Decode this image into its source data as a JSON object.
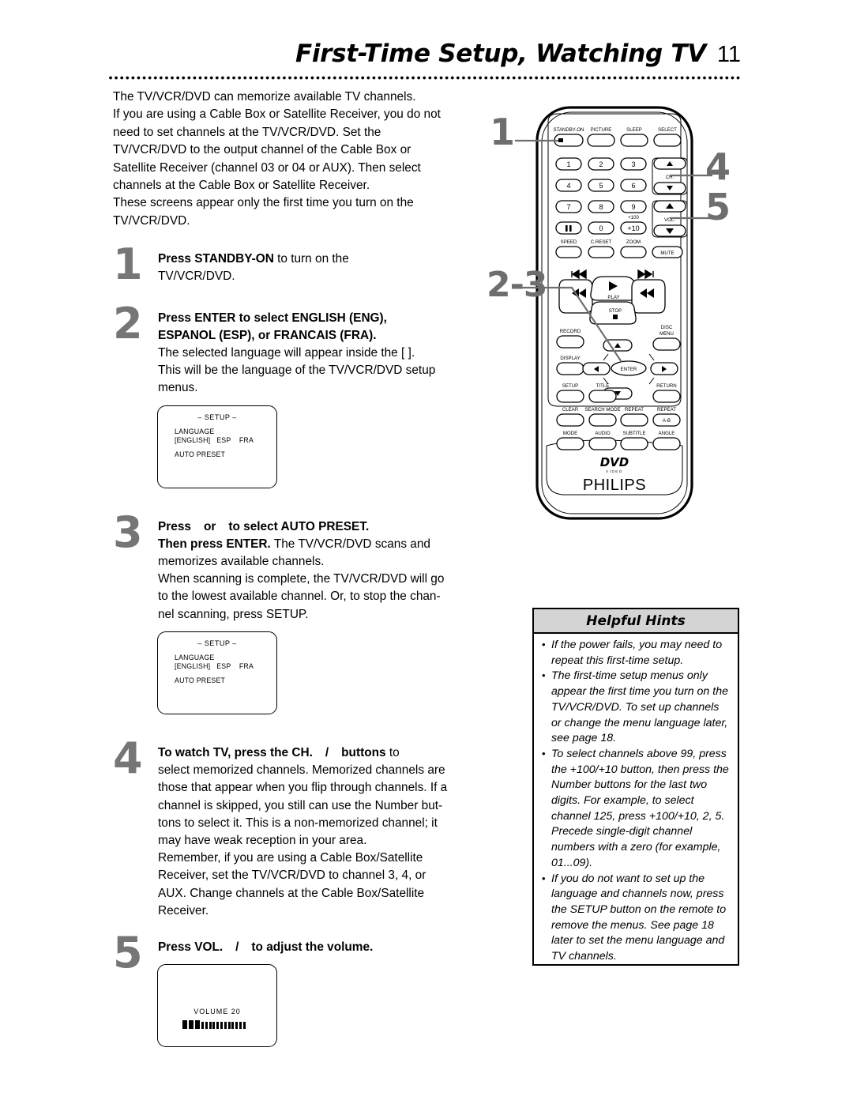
{
  "header": {
    "title": "First-Time Setup, Watching TV",
    "page_number": "11"
  },
  "intro": {
    "lines": [
      "The TV/VCR/DVD can memorize available TV channels.",
      "If you are using a Cable Box or Satellite Receiver, you do not",
      "need to set channels at the TV/VCR/DVD. Set the",
      "TV/VCR/DVD to the output channel of the Cable Box or",
      "Satellite Receiver (channel 03 or 04 or AUX). Then select",
      "channels at the Cable Box or Satellite Receiver.",
      "These screens appear only the first time you turn on the",
      "TV/VCR/DVD."
    ]
  },
  "steps": [
    {
      "number": "1",
      "bold_lead": "Press STANDBY-ON",
      "lead_rest": " to turn on the",
      "lines": [
        "TV/VCR/DVD."
      ]
    },
    {
      "number": "2",
      "bold_line_1": "Press ENTER to select ENGLISH (ENG),",
      "bold_line_2": "ESPANOL (ESP), or FRANCAIS (FRA).",
      "lines": [
        "The selected language will appear inside the [ ].",
        "This will be the language of the TV/VCR/DVD setup",
        "menus."
      ]
    },
    {
      "number": "3",
      "bold_line_1_a": "Press",
      "bold_line_1_b": "or",
      "bold_line_1_c": "to select AUTO PRESET.",
      "bold_line_2": "Then press ENTER.",
      "line_2_rest": " The TV/VCR/DVD scans and",
      "lines": [
        "memorizes available channels.",
        "When scanning is complete, the TV/VCR/DVD will go",
        "to the lowest available channel. Or, to stop the chan-",
        "nel scanning, press SETUP."
      ]
    },
    {
      "number": "4",
      "bold_line_1_a": "To watch TV, press the CH.",
      "bold_line_1_slash": "/",
      "bold_line_1_b": "buttons",
      "line_1_rest": " to",
      "lines": [
        "select memorized channels. Memorized channels are",
        "those that appear when you flip through channels. If a",
        "channel is skipped, you still can use the Number but-",
        "tons to select it. This is a non-memorized channel; it",
        "may have weak reception in your area.",
        "Remember, if you are using a Cable Box/Satellite",
        "Receiver, set the TV/VCR/DVD to channel 3, 4, or",
        "AUX. Change channels at the Cable Box/Satellite",
        "Receiver."
      ]
    },
    {
      "number": "5",
      "bold_line_1_a": "Press VOL.",
      "bold_line_1_slash": "/",
      "bold_line_1_b": "to adjust the volume."
    }
  ],
  "setup_screen": {
    "title": "– SETUP –",
    "line_1": "LANGUAGE",
    "line_2": "[ENGLISH]   ESP    FRA",
    "line_3": "AUTO PRESET"
  },
  "volume_screen": {
    "label": "VOLUME   20",
    "filled_segments": 3,
    "empty_segments": 12,
    "value": 20
  },
  "hints": {
    "title": "Helpful Hints",
    "items": [
      "If the power fails, you may need to repeat this first-time setup.",
      "The first-time setup menus only appear the first time you turn on the TV/VCR/DVD. To set up channels or change the menu language later, see page 18.",
      "To select channels above 99, press the +100/+10 button, then press the Number buttons for the last two digits.  For example, to select channel 125, press +100/+10, 2, 5. Precede single-digit channel numbers with a zero (for example, 01...09).",
      "If you do not want to set up the language and channels now, press the SETUP button on the remote to remove the menus. See page 18 later to set the menu language and TV channels."
    ]
  },
  "remote": {
    "brand": "PHILIPS",
    "disc_logo": "DVD",
    "disc_logo_sub": "VIDEO",
    "callouts": [
      {
        "id": "callout-1",
        "label": "1",
        "points_to": "standby-on-button"
      },
      {
        "id": "callout-23",
        "label": "2-3",
        "points_to": "enter-button"
      },
      {
        "id": "callout-4",
        "label": "4",
        "points_to": "channel-rocker"
      },
      {
        "id": "callout-5",
        "label": "5",
        "points_to": "volume-rocker"
      }
    ],
    "row_top": [
      "STANDBY-ON",
      "PICTURE",
      "SLEEP",
      "SELECT"
    ],
    "numpad": [
      "1",
      "2",
      "3",
      "4",
      "5",
      "6",
      "7",
      "8",
      "9",
      "II",
      "0",
      "+10"
    ],
    "plus_100_label": "+100",
    "ch_label": "CH.",
    "vol_label": "VOL.",
    "row_speed": [
      "SPEED",
      "C.RESET",
      "ZOOM"
    ],
    "mute_label": "MUTE",
    "transport": {
      "rew_skip": "◀◀|",
      "ffwd_skip": "|▶▶",
      "play": "PLAY",
      "stop": "STOP",
      "rew": "◀◀",
      "ffwd": "▶▶"
    },
    "row_record": [
      "RECORD",
      "DISC MENU"
    ],
    "row_display": [
      "DISPLAY",
      "ENTER"
    ],
    "row_setup": [
      "SETUP",
      "TITLE",
      "RETURN"
    ],
    "row_clear": [
      "CLEAR",
      "SEARCH MODE",
      "REPEAT",
      "REPEAT"
    ],
    "ab_label": "A-B",
    "row_mode": [
      "MODE",
      "AUDIO",
      "SUBTITLE",
      "ANGLE"
    ]
  },
  "colors": {
    "callout_gray": "#6e6e6e",
    "step_number_gray": "#767676",
    "hints_header_bg": "#d4d4d4",
    "ink": "#000000",
    "paper": "#ffffff"
  }
}
